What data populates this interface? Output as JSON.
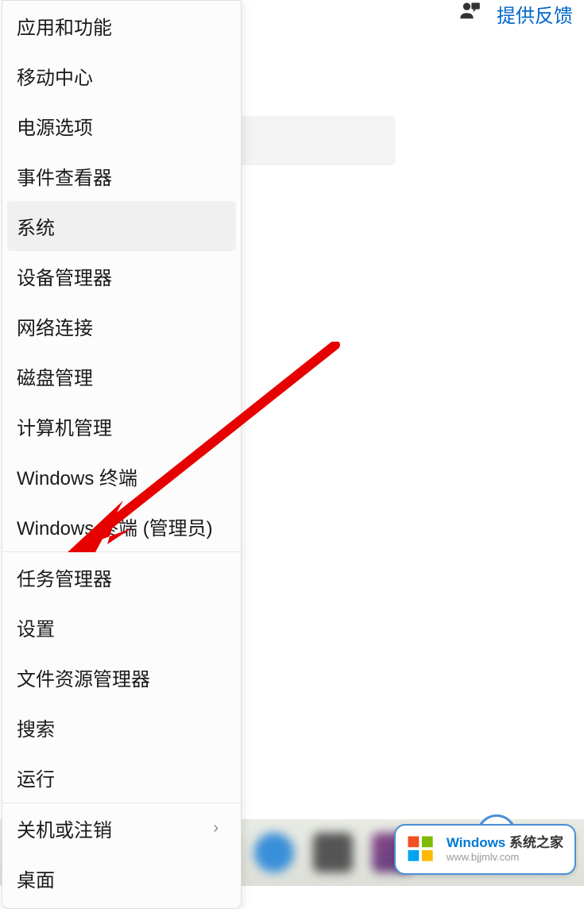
{
  "feedback": {
    "label": "提供反馈"
  },
  "menu": {
    "groups": [
      [
        {
          "key": "apps-features",
          "label": "应用和功能"
        },
        {
          "key": "mobility-center",
          "label": "移动中心"
        },
        {
          "key": "power-options",
          "label": "电源选项"
        },
        {
          "key": "event-viewer",
          "label": "事件查看器"
        },
        {
          "key": "system",
          "label": "系统",
          "hovered": true
        },
        {
          "key": "device-manager",
          "label": "设备管理器"
        },
        {
          "key": "network-connections",
          "label": "网络连接"
        },
        {
          "key": "disk-management",
          "label": "磁盘管理"
        },
        {
          "key": "computer-management",
          "label": "计算机管理"
        },
        {
          "key": "windows-terminal",
          "label": "Windows 终端"
        },
        {
          "key": "windows-terminal-admin",
          "label": "Windows 终端 (管理员)"
        }
      ],
      [
        {
          "key": "task-manager",
          "label": "任务管理器"
        },
        {
          "key": "settings",
          "label": "设置"
        },
        {
          "key": "file-explorer",
          "label": "文件资源管理器"
        },
        {
          "key": "search",
          "label": "搜索"
        },
        {
          "key": "run",
          "label": "运行"
        }
      ],
      [
        {
          "key": "shutdown-signout",
          "label": "关机或注销",
          "submenu": true
        },
        {
          "key": "desktop",
          "label": "桌面"
        }
      ]
    ]
  },
  "watermark": {
    "title_brand": "Windows",
    "title_suffix": " 系统之家",
    "url": "www.bjjmlv.com"
  },
  "annotation": {
    "arrow_color": "#e60000",
    "arrow_target": "settings"
  }
}
